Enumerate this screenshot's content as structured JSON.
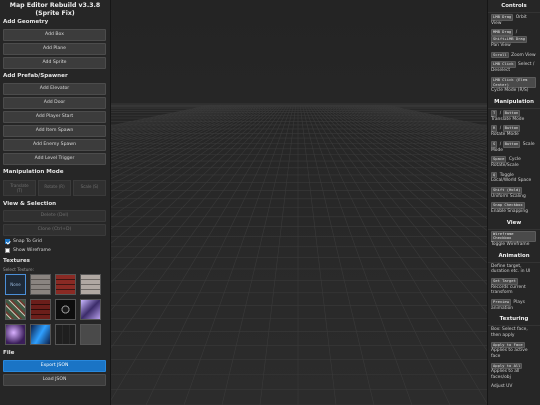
{
  "app": {
    "title_line1": "Map Editor Rebuild v3.3.8",
    "title_line2": "(Sprite Fix)"
  },
  "left": {
    "add_geometry": {
      "heading": "Add Geometry",
      "buttons": [
        "Add Box",
        "Add Plane",
        "Add Sprite"
      ]
    },
    "add_prefab": {
      "heading": "Add Prefab/Spawner",
      "buttons": [
        "Add Elevator",
        "Add Door",
        "Add Player Start",
        "Add Item Spawn",
        "Add Enemy Spawn",
        "Add Level Trigger"
      ]
    },
    "manipulation": {
      "heading": "Manipulation Mode",
      "modes": [
        {
          "label": "Translate",
          "key": "(T)"
        },
        {
          "label": "Rotate",
          "key": "(R)"
        },
        {
          "label": "Scale",
          "key": "(S)"
        }
      ]
    },
    "view_selection": {
      "heading": "View & Selection",
      "delete_label": "Delete (Del)",
      "clone_label": "Clone (Ctrl+D)",
      "snap_label": "Snap To Grid",
      "snap_checked": true,
      "wireframe_label": "Show Wireframe",
      "wireframe_checked": false
    },
    "textures": {
      "heading": "Textures",
      "select_label": "Select Texture:",
      "none_label": "None"
    },
    "file": {
      "heading": "File",
      "export_label": "Export JSON",
      "load_label": "Load JSON"
    }
  },
  "right": {
    "controls": {
      "heading": "Controls",
      "items": [
        {
          "keys": [
            "LMB Drag"
          ],
          "text": "Orbit View"
        },
        {
          "keys": [
            "MMB Drag",
            "Shift+LMB Drag"
          ],
          "text": "Pan View"
        },
        {
          "keys": [
            "Scroll"
          ],
          "text": "Zoom View"
        },
        {
          "keys": [
            "LMB Click"
          ],
          "text": "Select / Deselect"
        },
        {
          "keys": [
            "LMB Click (Elem Center)"
          ],
          "text": "Cycle Mode (R/S)"
        }
      ]
    },
    "manipulation": {
      "heading": "Manipulation",
      "items": [
        {
          "keys": [
            "T",
            "Button"
          ],
          "text": "Translate Mode"
        },
        {
          "keys": [
            "R",
            "Button"
          ],
          "text": "Rotate Mode"
        },
        {
          "keys": [
            "S",
            "Button"
          ],
          "text": "Scale Mode"
        },
        {
          "keys": [
            "Space"
          ],
          "text": "Cycle Rotate/Scale"
        },
        {
          "keys": [
            "Q"
          ],
          "text": "Toggle Local/World Space"
        },
        {
          "keys": [
            "Shift (Hold)"
          ],
          "text": "Uniform Scaling"
        },
        {
          "keys": [
            "Snap Checkbox"
          ],
          "text": "Enable Snapping"
        }
      ]
    },
    "view": {
      "heading": "View",
      "items": [
        {
          "keys": [
            "Wireframe Checkbox"
          ],
          "text": "Toggle Wireframe"
        }
      ]
    },
    "animation": {
      "heading": "Animation",
      "intro": "Define target, duration etc. in UI",
      "items": [
        {
          "keys": [
            "Set Target"
          ],
          "text": "Records current transform"
        },
        {
          "keys": [
            "Preview"
          ],
          "text": "Plays animation"
        }
      ]
    },
    "texturing": {
      "heading": "Texturing",
      "intro": "Box: Select face, then apply",
      "items": [
        {
          "keys": [
            "Apply to Face"
          ],
          "text": "Applies to active face"
        },
        {
          "keys": [
            "Apply to All"
          ],
          "text": "Applies to all faces/obj"
        }
      ],
      "tail": "Adjust UV"
    }
  },
  "colors": {
    "accent": "#1a74c5",
    "panel_bg": "#262626",
    "viewport_bg": "#2a2a2a",
    "grid_line": "#3a3a3a"
  },
  "textures": [
    {
      "id": "none",
      "icon": "none-swatch"
    },
    {
      "id": "stone-bricks",
      "icon": "texture-swatch"
    },
    {
      "id": "red-bricks",
      "icon": "texture-swatch"
    },
    {
      "id": "mossy-stone",
      "icon": "texture-swatch"
    },
    {
      "id": "green-mosaic",
      "icon": "texture-swatch"
    },
    {
      "id": "dark-red-bricks",
      "icon": "texture-swatch"
    },
    {
      "id": "dark-circle",
      "icon": "texture-swatch"
    },
    {
      "id": "purple-crystal",
      "icon": "texture-swatch"
    },
    {
      "id": "purple-glow",
      "icon": "texture-swatch"
    },
    {
      "id": "blue-crystal",
      "icon": "texture-swatch"
    },
    {
      "id": "dark-tiles",
      "icon": "texture-swatch"
    },
    {
      "id": "gray-metal",
      "icon": "texture-swatch"
    }
  ]
}
